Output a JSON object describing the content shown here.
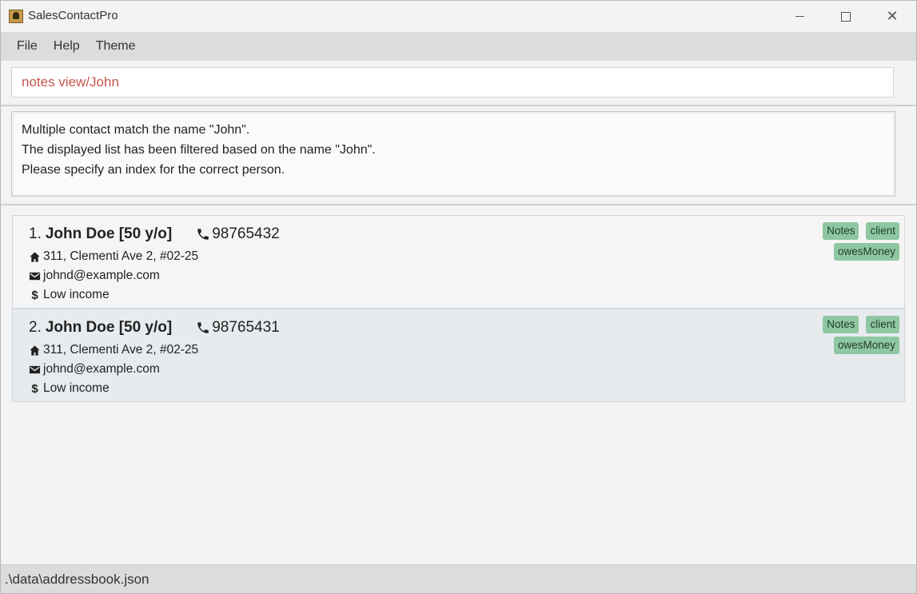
{
  "window": {
    "title": "SalesContactPro",
    "controls": {
      "minimize": "minimize",
      "maximize": "maximize",
      "close": "✕"
    }
  },
  "menu": [
    {
      "label": "File"
    },
    {
      "label": "Help"
    },
    {
      "label": "Theme"
    }
  ],
  "command": {
    "value": "notes view/John",
    "color": "#c4554a"
  },
  "result": {
    "lines": [
      "Multiple contact match the name \"John\".",
      "The displayed list has been filtered based on the name \"John\".",
      "Please specify an index for the correct person."
    ]
  },
  "contacts": [
    {
      "index": "1.",
      "name": "John Doe [50 y/o]",
      "phone": "98765432",
      "address": "311, Clementi Ave 2, #02-25",
      "email": "johnd@example.com",
      "income": "Low income",
      "tags": [
        "Notes",
        "client",
        "owesMoney"
      ]
    },
    {
      "index": "2.",
      "name": "John Doe [50 y/o]",
      "phone": "98765431",
      "address": "311, Clementi Ave 2, #02-25",
      "email": "johnd@example.com",
      "income": "Low income",
      "tags": [
        "Notes",
        "client",
        "owesMoney"
      ]
    }
  ],
  "status": {
    "path": ".\\data\\addressbook.json"
  },
  "colors": {
    "tag_bg": "#8fc7a2",
    "selected_card": "#e7ebee"
  }
}
